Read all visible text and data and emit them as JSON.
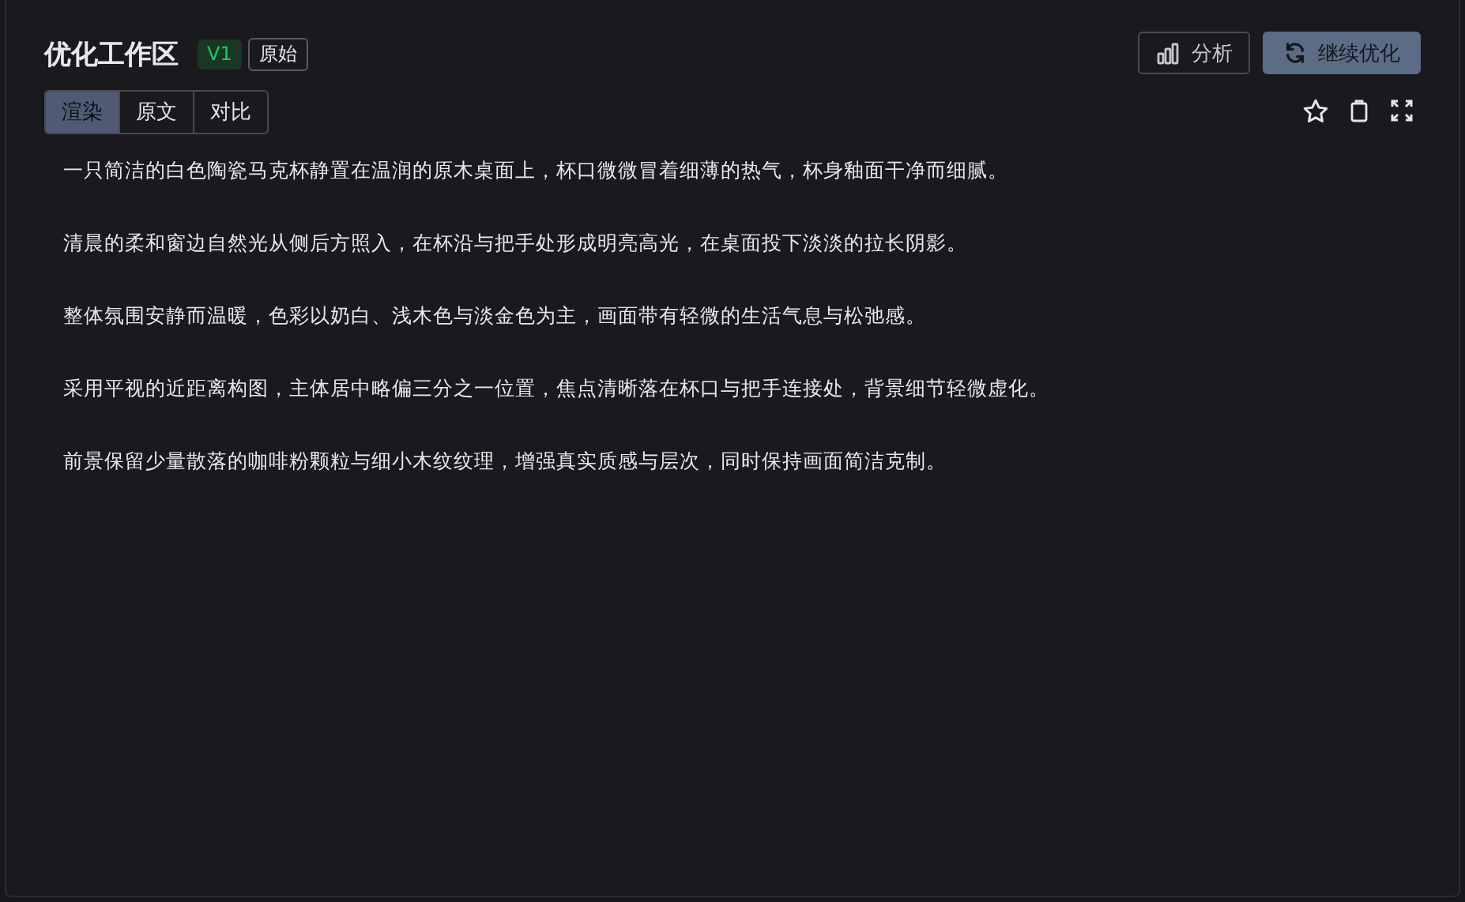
{
  "panel": {
    "title": "优化工作区",
    "badges": [
      {
        "kind": "version",
        "label": "V1"
      },
      {
        "kind": "tag",
        "label": "原始"
      }
    ]
  },
  "actions": [
    {
      "kind": "analyze",
      "label": "分析",
      "primary": false
    },
    {
      "kind": "refresh",
      "label": "继续优化",
      "primary": true
    }
  ],
  "view_tabs": [
    {
      "label": "渲染",
      "selected": true
    },
    {
      "label": "原文",
      "selected": false
    },
    {
      "label": "对比",
      "selected": false
    }
  ],
  "toolbar": [
    {
      "kind": "star"
    },
    {
      "kind": "clipboard"
    },
    {
      "kind": "expand"
    }
  ],
  "paragraphs": [
    "一只简洁的白色陶瓷马克杯静置在温润的原木桌面上，杯口微微冒着细薄的热气，杯身釉面干净而细腻。",
    "清晨的柔和窗边自然光从侧后方照入，在杯沿与把手处形成明亮高光，在桌面投下淡淡的拉长阴影。",
    "整体氛围安静而温暖，色彩以奶白、浅木色与淡金色为主，画面带有轻微的生活气息与松弛感。",
    "采用平视的近距离构图，主体居中略偏三分之一位置，焦点清晰落在杯口与把手连接处，背景细节轻微虚化。",
    "前景保留少量散落的咖啡粉颗粒与细小木纹纹理，增强真实质感与层次，同时保持画面简洁克制。"
  ]
}
